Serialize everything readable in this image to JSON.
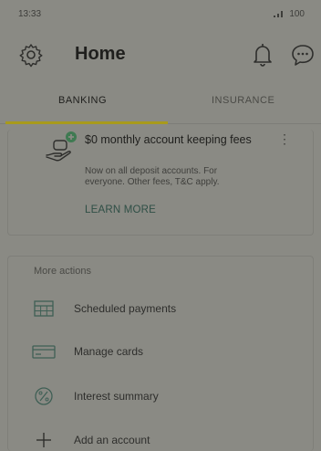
{
  "status_bar": {
    "time": "13:33",
    "battery": "100"
  },
  "header": {
    "title": "Home"
  },
  "tabs": [
    {
      "label": "BANKING"
    },
    {
      "label": "INSURANCE"
    }
  ],
  "promo": {
    "title": "$0 monthly account keeping fees",
    "body": "Now on all deposit accounts. For everyone. Other fees, T&C apply.",
    "link": "LEARN MORE"
  },
  "more_actions": {
    "label": "More actions",
    "items": [
      {
        "label": "Scheduled payments",
        "icon": "calendar-icon"
      },
      {
        "label": "Manage cards",
        "icon": "card-icon"
      },
      {
        "label": "Interest summary",
        "icon": "percent-icon"
      },
      {
        "label": "Add an account",
        "icon": "plus-icon"
      }
    ]
  },
  "colors": {
    "tab_indicator": "#a89a1c",
    "promo_badge": "#3f7a52",
    "link": "#2f4f46"
  }
}
